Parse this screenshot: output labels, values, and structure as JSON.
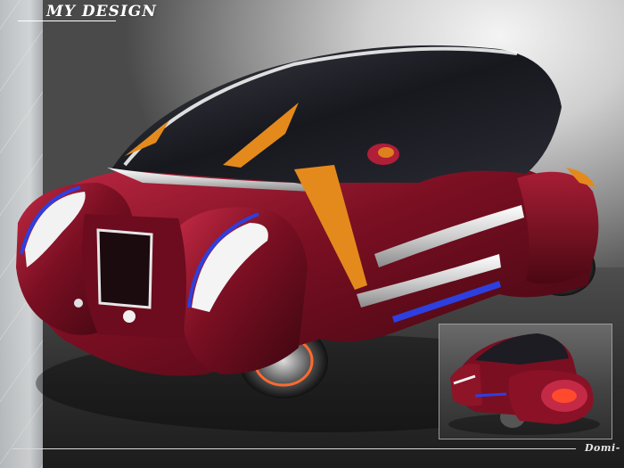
{
  "title": "MY DESIGN",
  "signature": "Domi-",
  "colors": {
    "body": "#7a0f22",
    "body_highlight": "#c0243e",
    "glass": "#1c1c22",
    "accent_orange": "#e48a1c",
    "accent_blue": "#2e3fe0",
    "chrome": "#e6e6e6"
  },
  "icons": {
    "main_render": "car-render-icon",
    "inset_render": "car-rear-view-icon"
  }
}
